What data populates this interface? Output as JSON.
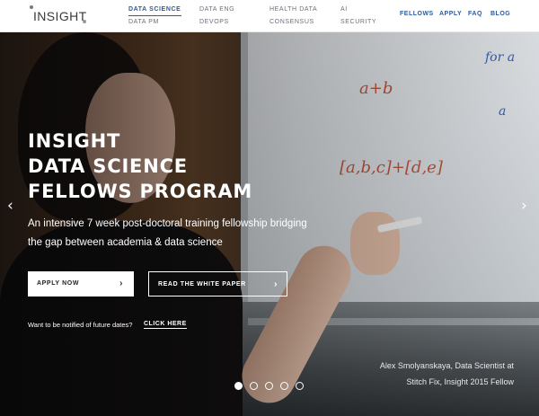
{
  "logo": {
    "text": "INSIGHT"
  },
  "nav": {
    "primary": [
      {
        "label": "DATA SCIENCE",
        "active": true
      },
      {
        "label": "DATA PM"
      },
      {
        "label": "DATA ENG"
      },
      {
        "label": "DEVOPS"
      },
      {
        "label": "HEALTH DATA"
      },
      {
        "label": "CONSENSUS"
      },
      {
        "label": "AI"
      },
      {
        "label": "SECURITY"
      }
    ],
    "secondary": [
      {
        "label": "FELLOWS"
      },
      {
        "label": "APPLY"
      },
      {
        "label": "FAQ"
      },
      {
        "label": "BLOG"
      }
    ]
  },
  "hero": {
    "headline": [
      "INSIGHT",
      "DATA SCIENCE",
      "FELLOWS PROGRAM"
    ],
    "subline": [
      "An intensive 7 week post-doctoral training fellowship bridging",
      "the gap between academia & data science"
    ],
    "apply_label": "APPLY NOW",
    "paper_label": "READ THE WHITE PAPER",
    "notify_text": "Want to be notified of future dates?",
    "notify_link": "CLICK HERE",
    "caption": [
      "Alex Smolyanskaya, Data Scientist at",
      "Stitch Fix, Insight 2015 Fellow"
    ],
    "prev_arrow": "‹",
    "next_arrow": "›",
    "slide_count": 5,
    "active_slide": 1
  },
  "colors": {
    "nav_active": "#2e5a9c",
    "nav_text": "#6a6f7c"
  },
  "icons": {
    "chevron": "chevron-right-icon",
    "prev": "arrow-left-icon",
    "next": "arrow-right-icon"
  }
}
